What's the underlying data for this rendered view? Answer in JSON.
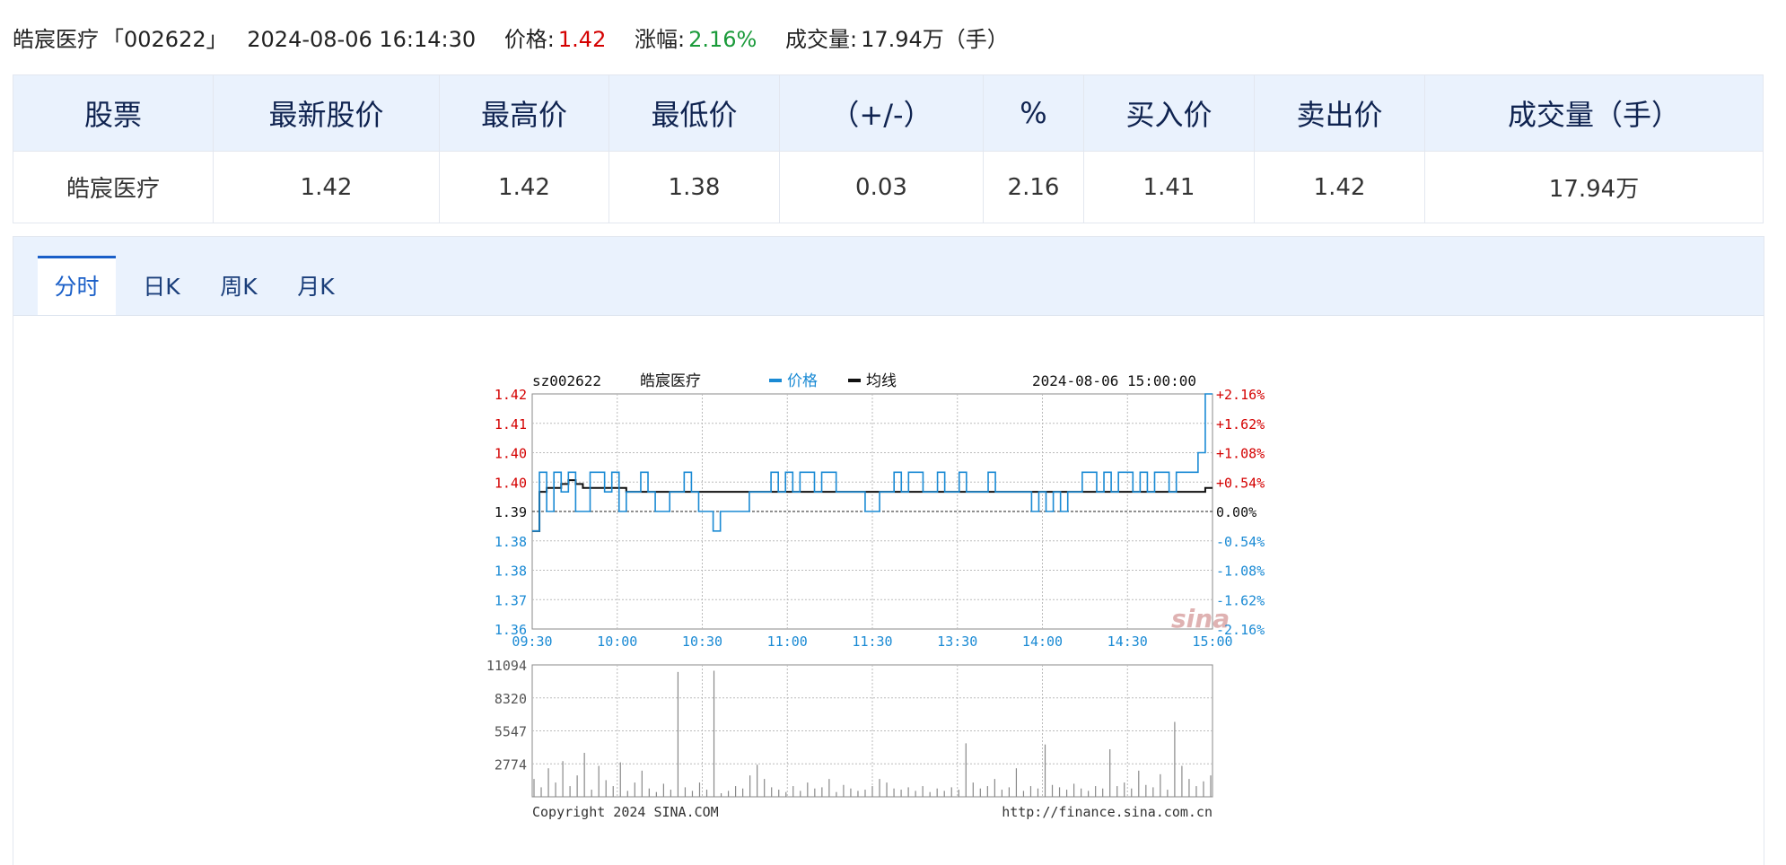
{
  "quote": {
    "name": "皓宸医疗",
    "code_bracket": "「002622」",
    "datetime": "2024-08-06 16:14:30",
    "price_label": "价格:",
    "price": "1.42",
    "change_label": "涨幅:",
    "change_pct": "2.16%",
    "volume_label": "成交量:",
    "volume": "17.94万（手）"
  },
  "table": {
    "headers": [
      "股票",
      "最新股价",
      "最高价",
      "最低价",
      "（+/-）",
      "%",
      "买入价",
      "卖出价",
      "成交量（手）"
    ],
    "row": [
      "皓宸医疗",
      "1.42",
      "1.42",
      "1.38",
      "0.03",
      "2.16",
      "1.41",
      "1.42",
      "17.94万"
    ]
  },
  "tabs": [
    {
      "label": "分时",
      "active": true
    },
    {
      "label": "日K",
      "active": false
    },
    {
      "label": "周K",
      "active": false
    },
    {
      "label": "月K",
      "active": false
    }
  ],
  "colors": {
    "price_line": "#1a8ad4",
    "avg_line": "#111111",
    "up": "#d40000",
    "down": "#1a8ad4",
    "axis_blue": "#1a8ad4"
  },
  "chart_data": {
    "type": "line",
    "header": {
      "code": "sz002622",
      "name": "皓宸医疗",
      "legend_price": "价格",
      "legend_avg": "均线",
      "datetime": "2024-08-06 15:00:00"
    },
    "watermark": "sina",
    "y_left_labels": [
      "1.42",
      "1.41",
      "1.40",
      "1.40",
      "1.39",
      "1.38",
      "1.38",
      "1.37",
      "1.36"
    ],
    "y_right_labels": [
      "+2.16%",
      "+1.62%",
      "+1.08%",
      "+0.54%",
      "0.00%",
      "-0.54%",
      "-1.08%",
      "-1.62%",
      "-2.16%"
    ],
    "ylim": [
      1.36,
      1.42
    ],
    "prev_close": 1.39,
    "x_labels": [
      "09:30",
      "10:00",
      "10:30",
      "11:00",
      "11:30",
      "13:30",
      "14:00",
      "14:30",
      "15:00"
    ],
    "series": [
      {
        "name": "价格",
        "values": [
          1.385,
          1.4,
          1.39,
          1.4,
          1.395,
          1.4,
          1.39,
          1.39,
          1.4,
          1.4,
          1.395,
          1.4,
          1.39,
          1.395,
          1.395,
          1.4,
          1.395,
          1.39,
          1.39,
          1.395,
          1.395,
          1.4,
          1.395,
          1.39,
          1.39,
          1.385,
          1.39,
          1.39,
          1.39,
          1.39,
          1.395,
          1.395,
          1.395,
          1.4,
          1.395,
          1.4,
          1.395,
          1.4,
          1.4,
          1.395,
          1.4,
          1.4,
          1.395,
          1.395,
          1.395,
          1.395,
          1.39,
          1.39,
          1.395,
          1.395,
          1.4,
          1.395,
          1.4,
          1.4,
          1.395,
          1.395,
          1.4,
          1.395,
          1.395,
          1.4,
          1.395,
          1.395,
          1.395,
          1.4,
          1.395,
          1.395,
          1.395,
          1.395,
          1.395,
          1.39,
          1.395,
          1.39,
          1.395,
          1.39,
          1.395,
          1.395,
          1.4,
          1.4,
          1.395,
          1.4,
          1.395,
          1.4,
          1.4,
          1.395,
          1.4,
          1.395,
          1.4,
          1.4,
          1.395,
          1.4,
          1.4,
          1.4,
          1.405,
          1.42,
          1.42
        ]
      },
      {
        "name": "均线",
        "values": [
          1.385,
          1.395,
          1.396,
          1.396,
          1.397,
          1.398,
          1.397,
          1.396,
          1.396,
          1.396,
          1.396,
          1.396,
          1.396,
          1.395,
          1.395,
          1.395,
          1.395,
          1.395,
          1.395,
          1.395,
          1.395,
          1.395,
          1.395,
          1.395,
          1.395,
          1.395,
          1.395,
          1.395,
          1.395,
          1.395,
          1.395,
          1.395,
          1.395,
          1.395,
          1.395,
          1.395,
          1.395,
          1.395,
          1.395,
          1.395,
          1.395,
          1.395,
          1.395,
          1.395,
          1.395,
          1.395,
          1.395,
          1.395,
          1.395,
          1.395,
          1.395,
          1.395,
          1.395,
          1.395,
          1.395,
          1.395,
          1.395,
          1.395,
          1.395,
          1.395,
          1.395,
          1.395,
          1.395,
          1.395,
          1.395,
          1.395,
          1.395,
          1.395,
          1.395,
          1.395,
          1.395,
          1.395,
          1.395,
          1.395,
          1.395,
          1.395,
          1.395,
          1.395,
          1.395,
          1.395,
          1.395,
          1.395,
          1.395,
          1.395,
          1.395,
          1.395,
          1.395,
          1.395,
          1.395,
          1.395,
          1.395,
          1.395,
          1.395,
          1.396,
          1.396
        ]
      }
    ],
    "volume": {
      "y_labels": [
        "11094",
        "8320",
        "5547",
        "2774"
      ],
      "ylim": [
        0,
        11094
      ],
      "values": [
        1500,
        800,
        2400,
        1200,
        3000,
        900,
        1800,
        3700,
        600,
        2600,
        1400,
        900,
        2900,
        500,
        1200,
        2200,
        700,
        400,
        1100,
        600,
        10500,
        800,
        500,
        1200,
        600,
        10600,
        300,
        500,
        900,
        700,
        1800,
        2700,
        1500,
        800,
        600,
        400,
        900,
        500,
        1200,
        700,
        800,
        1500,
        400,
        1000,
        700,
        500,
        600,
        900,
        1500,
        1200,
        700,
        600,
        800,
        500,
        900,
        400,
        700,
        500,
        800,
        600,
        4500,
        1200,
        700,
        900,
        1500,
        600,
        800,
        2400,
        500,
        900,
        700,
        4400,
        1000,
        800,
        600,
        1100,
        700,
        500,
        900,
        700,
        4000,
        900,
        1200,
        700,
        2200,
        1000,
        800,
        1900,
        600,
        6300,
        2600,
        1500,
        900,
        1300,
        1800
      ]
    },
    "footer_left": "Copyright 2024 SINA.COM",
    "footer_right": "http://finance.sina.com.cn"
  }
}
